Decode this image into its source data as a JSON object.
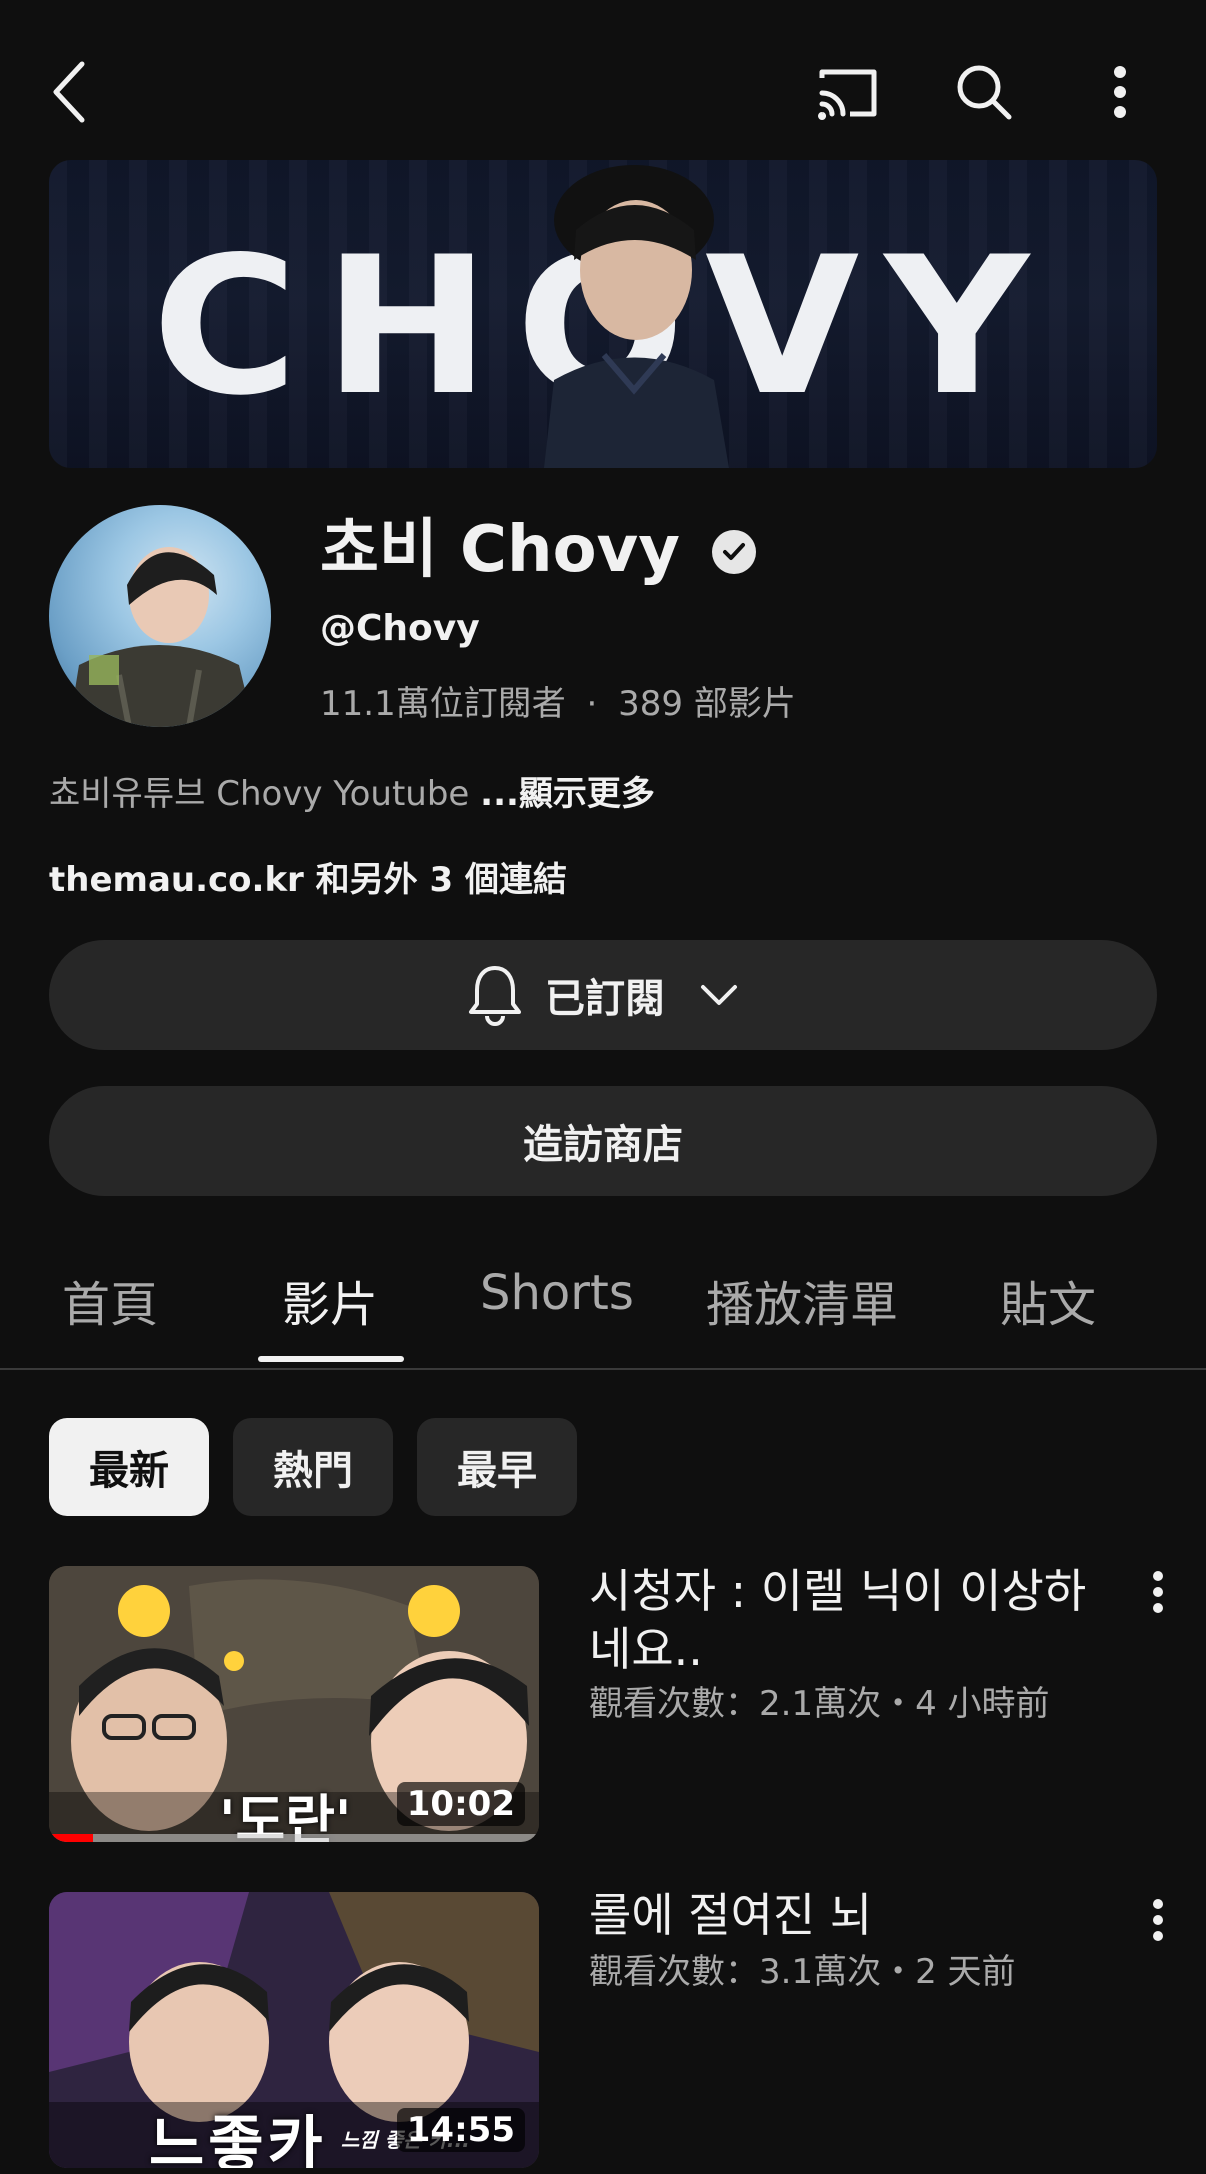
{
  "banner": {
    "text": "CHOVY"
  },
  "channel": {
    "name": "쵸비 Chovy",
    "handle": "@Chovy",
    "subscribers": "11.1萬位訂閱者",
    "separator": "·",
    "videos": "389 部影片",
    "description": "쵸비유튜브 Chovy Youtube",
    "show_more": "...顯示更多",
    "links": "themau.co.kr 和另外 3 個連結"
  },
  "buttons": {
    "subscribed": "已訂閱",
    "visit_store": "造訪商店"
  },
  "tabs": [
    {
      "label": "首頁"
    },
    {
      "label": "影片"
    },
    {
      "label": "Shorts"
    },
    {
      "label": "播放清單"
    },
    {
      "label": "貼文"
    }
  ],
  "active_tab": "影片",
  "chips": [
    {
      "label": "最新"
    },
    {
      "label": "熱門"
    },
    {
      "label": "最早"
    }
  ],
  "active_chip": "最新",
  "videos": [
    {
      "title": "시청자 : 이렐 닉이 이상하네요..",
      "meta": "觀看次數：2.1萬次・4 小時前",
      "duration": "10:02",
      "thumb_caption": "'도란'",
      "watched_fraction": 0.09
    },
    {
      "title": "롤에 절여진 뇌",
      "meta": "觀看次數：3.1萬次・2 天前",
      "duration": "14:55",
      "thumb_caption": "느좋카",
      "thumb_subcaption": "느낌 좋은 카..."
    }
  ],
  "colors": {
    "background": "#0f0f0f",
    "surface": "#272727",
    "text_primary": "#f1f1f1",
    "text_secondary": "#aaaaaa",
    "progress_red": "#ff0000"
  },
  "icons": [
    "back-icon",
    "cast-icon",
    "search-icon",
    "more-vert-icon",
    "verified-icon",
    "bell-icon",
    "chevron-down-icon"
  ]
}
